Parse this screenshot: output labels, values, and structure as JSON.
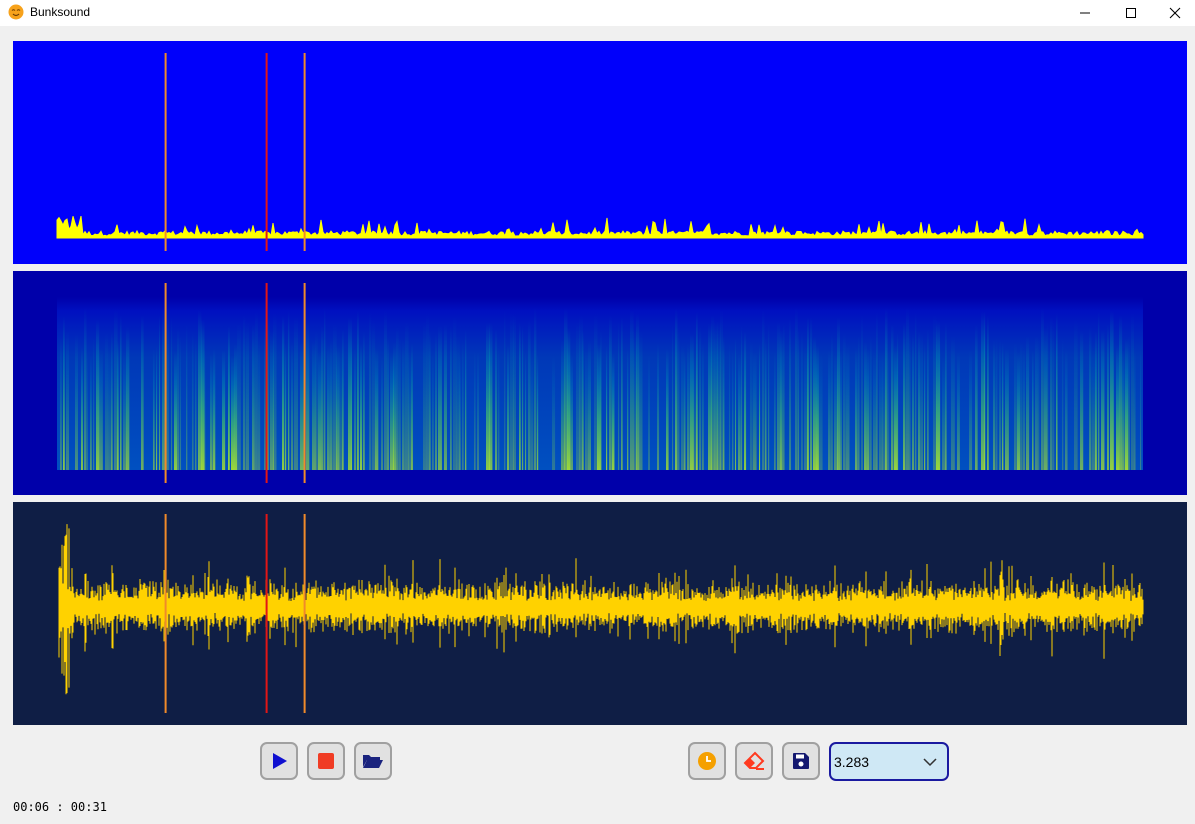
{
  "window": {
    "title": "Bunksound",
    "icon": "smiling-face-icon",
    "controls": [
      "minimize-icon",
      "maximize-icon",
      "close-icon"
    ]
  },
  "colors": {
    "spectrum_bg": "#0000fb",
    "spectrum_trace": "#ffff00",
    "spectrogram_bg": "#0000aa",
    "waveform_bg": "#0f1e45",
    "waveform_trace": "#ffd200",
    "cursor_main": "#e21616",
    "cursor_bounds": "#f08a2a",
    "play": "#1010d0",
    "stop": "#f03c24",
    "clock": "#f5a000",
    "erase": "#ff3a20",
    "save": "#141870"
  },
  "markers": {
    "left": 0.1,
    "center": 0.193,
    "right": 0.228
  },
  "transport": {
    "play_icon": "play-icon",
    "stop_icon": "stop-icon",
    "open_icon": "folder-open-icon"
  },
  "tools": {
    "clock_icon": "clock-icon",
    "erase_icon": "eraser-icon",
    "save_icon": "save-icon"
  },
  "zoom_select": {
    "value": "3.283"
  },
  "status": {
    "time_readout": "00:06 : 00:31"
  }
}
